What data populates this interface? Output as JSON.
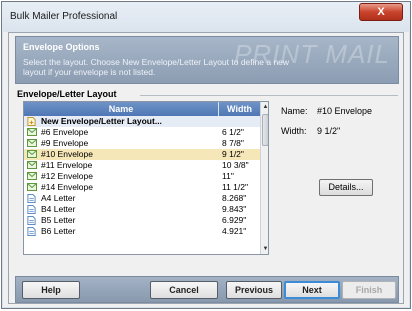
{
  "window": {
    "title": "Bulk Mailer Professional",
    "close_label": "X"
  },
  "header": {
    "title": "Envelope Options",
    "description": "Select the layout. Choose New Envelope/Letter Layout to define a new layout if your envelope is not listed.",
    "brand": "PRINT MAIL"
  },
  "group_label": "Envelope/Letter Layout",
  "list": {
    "columns": {
      "name": "Name",
      "width": "Width"
    },
    "rows": [
      {
        "icon": "new-layout-icon",
        "name": "New Envelope/Letter Layout...",
        "width": ""
      },
      {
        "icon": "envelope-icon",
        "name": "#6 Envelope",
        "width": "6 1/2\""
      },
      {
        "icon": "envelope-icon",
        "name": "#9 Envelope",
        "width": "8 7/8\""
      },
      {
        "icon": "envelope-icon",
        "name": "#10 Envelope",
        "width": "9 1/2\""
      },
      {
        "icon": "envelope-icon",
        "name": "#11 Envelope",
        "width": "10 3/8\""
      },
      {
        "icon": "envelope-icon",
        "name": "#12 Envelope",
        "width": "11\""
      },
      {
        "icon": "envelope-icon",
        "name": "#14 Envelope",
        "width": "11 1/2\""
      },
      {
        "icon": "letter-icon",
        "name": "A4 Letter",
        "width": "8.268\""
      },
      {
        "icon": "letter-icon",
        "name": "B4 Letter",
        "width": "9.843\""
      },
      {
        "icon": "letter-icon",
        "name": "B5 Letter",
        "width": "6.929\""
      },
      {
        "icon": "letter-icon",
        "name": "B6 Letter",
        "width": "4.921\""
      }
    ],
    "selected_index": 3
  },
  "details": {
    "name_label": "Name:",
    "name_value": "#10 Envelope",
    "width_label": "Width:",
    "width_value": "9 1/2\"",
    "details_button": "Details..."
  },
  "buttons": {
    "help": "Help",
    "cancel": "Cancel",
    "previous": "Previous",
    "next": "Next",
    "finish": "Finish"
  },
  "colors": {
    "accent": "#3b8bd6",
    "header": "#8c9db3",
    "selected_row": "#f6e7b9"
  }
}
